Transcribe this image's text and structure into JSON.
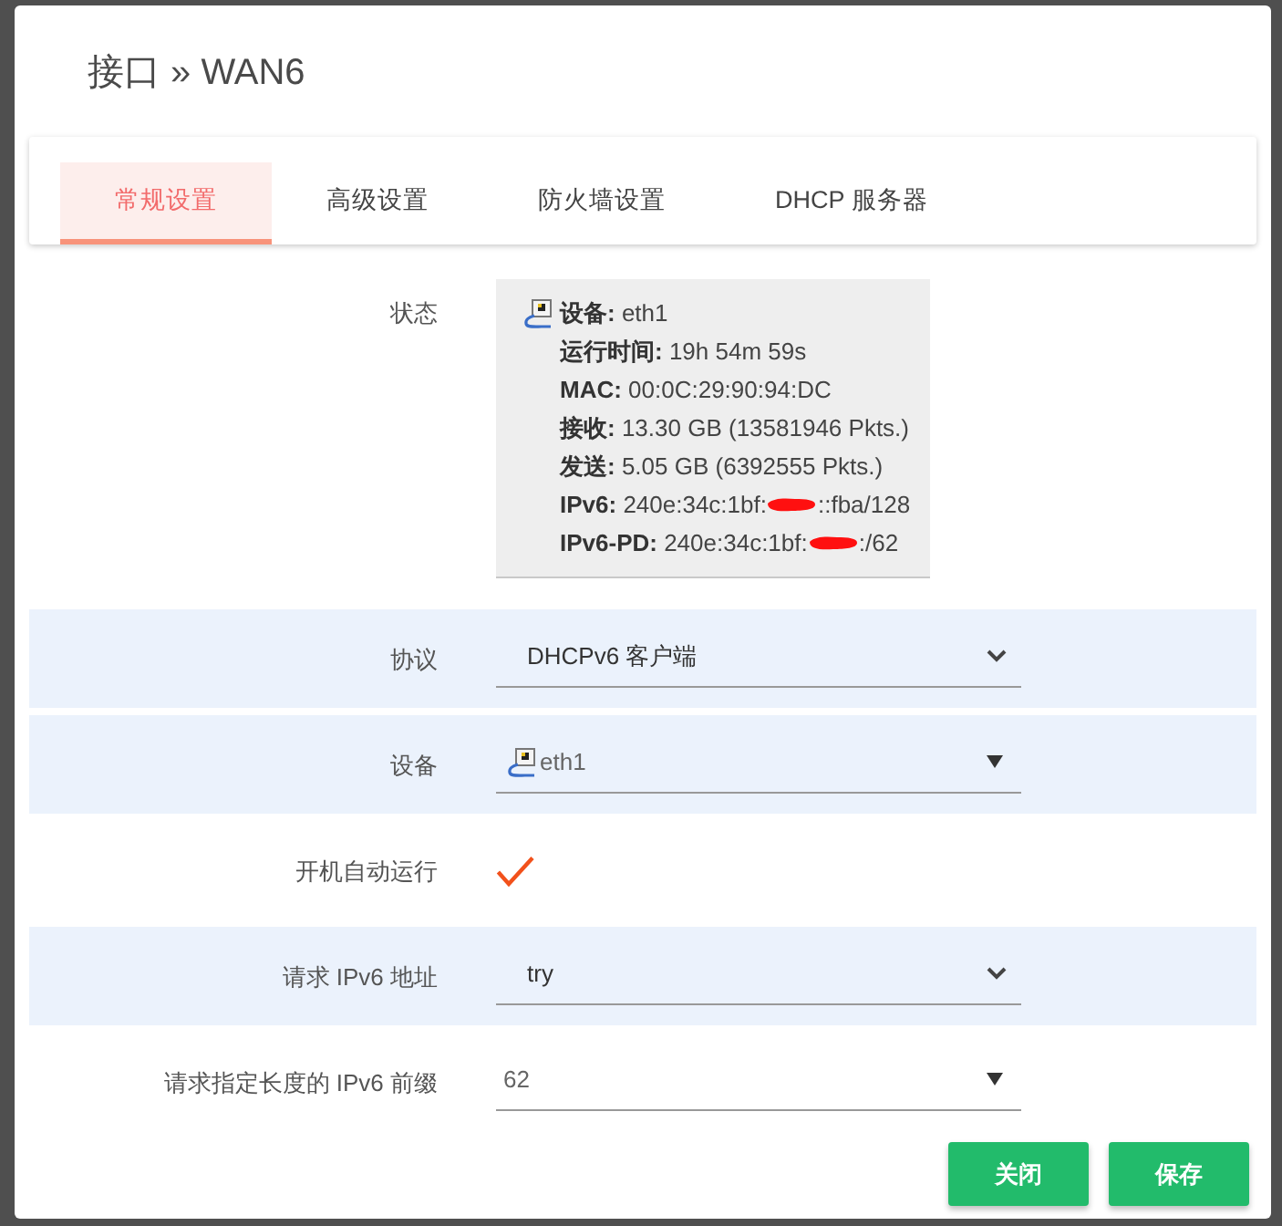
{
  "dialog": {
    "title": "接口 » WAN6"
  },
  "tabs": [
    {
      "label": "常规设置",
      "selected": true
    },
    {
      "label": "高级设置",
      "selected": false
    },
    {
      "label": "防火墙设置",
      "selected": false
    },
    {
      "label": "DHCP 服务器",
      "selected": false
    }
  ],
  "fields": [
    {
      "kind": "status",
      "label": "状态",
      "shaded": false,
      "lines": [
        {
          "kind": "device",
          "label": "设备:",
          "value": "eth1",
          "redacted": false
        },
        {
          "kind": "text",
          "label": "运行时间:",
          "value": "19h 54m 59s",
          "redacted": false
        },
        {
          "kind": "text",
          "label": "MAC:",
          "value": "00:0C:29:90:94:DC",
          "redacted": false
        },
        {
          "kind": "text",
          "label": "接收:",
          "value": "13.30 GB (13581946 Pkts.)",
          "redacted": false
        },
        {
          "kind": "text",
          "label": "发送:",
          "value": "5.05 GB (6392555 Pkts.)",
          "redacted": false
        },
        {
          "kind": "text",
          "label": "IPv6:",
          "value": "240e:34c:1bf:",
          "redacted": true,
          "value_end": "::fba/128"
        },
        {
          "kind": "text",
          "label": "IPv6-PD:",
          "value": "240e:34c:1bf:",
          "redacted": true,
          "value_end": ":/62"
        }
      ]
    },
    {
      "kind": "select",
      "label": "协议",
      "shaded": true,
      "value": "DHCPv6 客户端"
    },
    {
      "kind": "device_dropdown",
      "label": "设备",
      "shaded": true,
      "value": "eth1"
    },
    {
      "kind": "checkbox",
      "label": "开机自动运行",
      "shaded": false,
      "checked": true
    },
    {
      "kind": "select",
      "label": "请求 IPv6 地址",
      "shaded": true,
      "value": "try"
    },
    {
      "kind": "dropdown",
      "label": "请求指定长度的 IPv6 前缀",
      "shaded": false,
      "value": "62"
    }
  ],
  "buttons": [
    {
      "label": "关闭"
    },
    {
      "label": "保存"
    }
  ]
}
